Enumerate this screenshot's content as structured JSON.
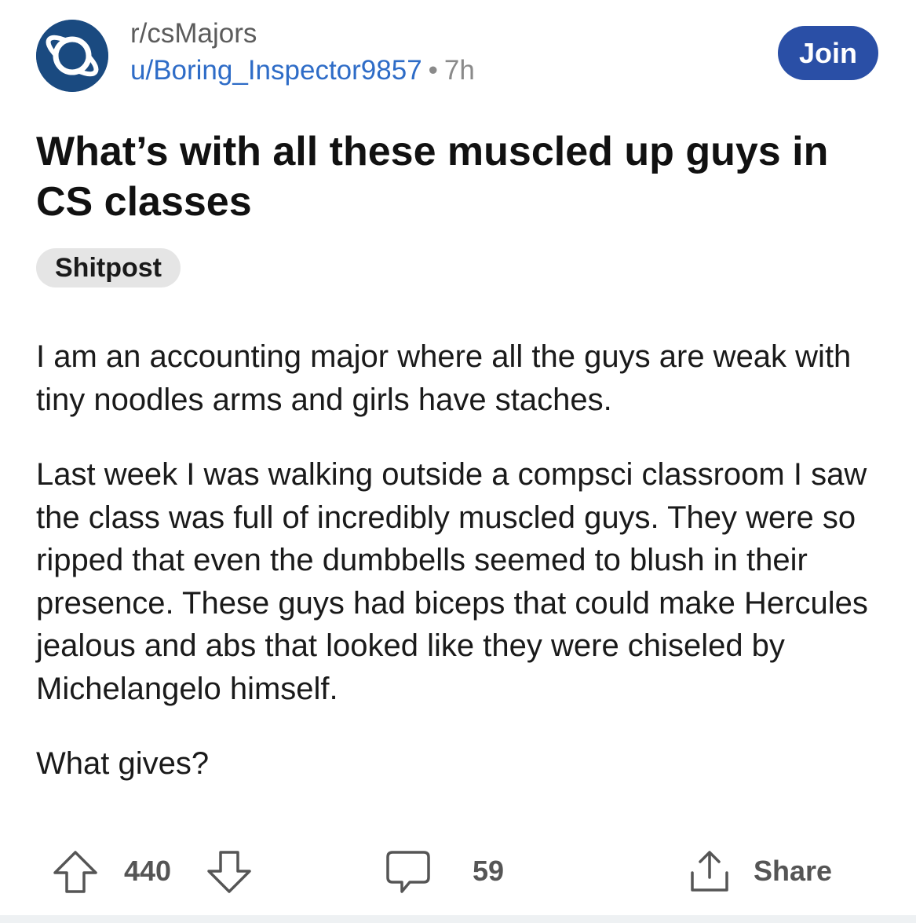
{
  "subreddit": "r/csMajors",
  "author": "u/Boring_Inspector9857",
  "separator": "•",
  "time_ago": "7h",
  "join_label": "Join",
  "title": "What’s with all these muscled up guys in CS classes",
  "flair": "Shitpost",
  "body": [
    "I am an accounting major where all the guys are weak with tiny noodles arms and girls have staches.",
    "Last week I was walking outside a compsci classroom I saw the class was full of incredibly muscled guys. They were so ripped that even the dumbbells seemed to blush in their presence. These guys had biceps that could make Hercules jealous and abs that looked like they were chiseled by Michelangelo himself.",
    "What gives?"
  ],
  "actions": {
    "upvotes": "440",
    "comments": "59",
    "share_label": "Share"
  },
  "colors": {
    "avatar_bg": "#1a4a80",
    "join_bg": "#2a4fa6",
    "author_link": "#2e6cc7",
    "flair_bg": "#e5e5e5"
  },
  "icons": [
    "planet-icon",
    "upvote-icon",
    "downvote-icon",
    "comment-icon",
    "share-icon"
  ]
}
